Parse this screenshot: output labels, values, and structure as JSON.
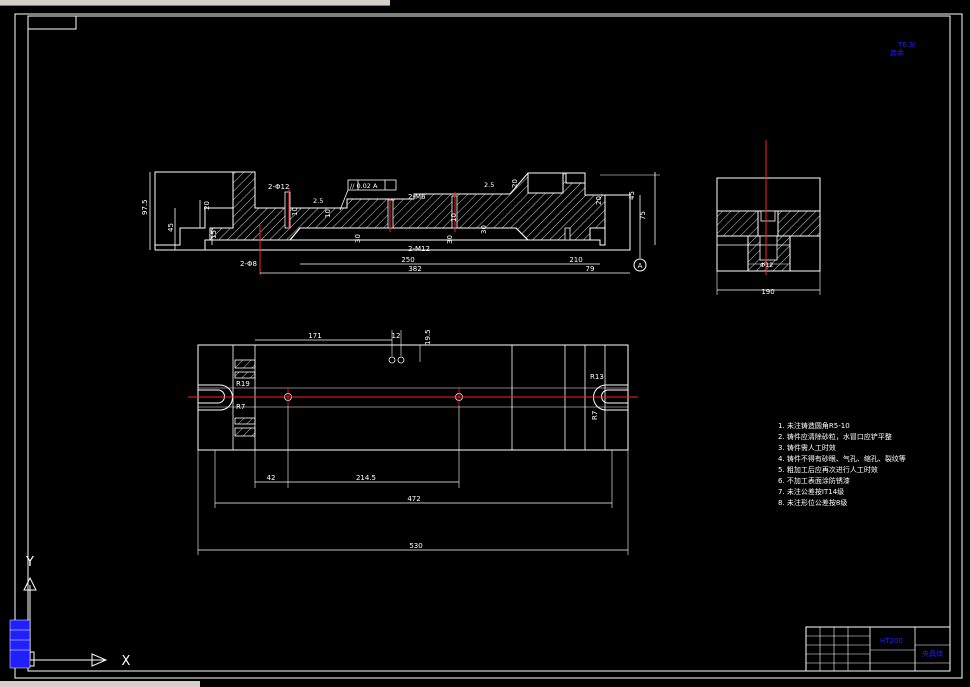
{
  "drawing": {
    "dims": {
      "front": {
        "d97_5": "97.5",
        "d45": "45",
        "d20a": "20",
        "d15": "15",
        "d2_phi12": "2-Φ12",
        "d10a": "10",
        "d2_5a": "2.5",
        "d30a": "30",
        "d2_m6": "2-M6",
        "d2_m12": "2-M12",
        "d10b": "10",
        "d30b": "30",
        "d30c": "30",
        "d2_5b": "2.5",
        "d10c": "10",
        "d20b": "20",
        "d45b": "45",
        "d75": "75",
        "d2_bar": "2-Φ8",
        "d250": "250",
        "d210": "210",
        "d382": "382",
        "d79": "79",
        "tolerance": "// 0.02 A",
        "datum": "A"
      },
      "side": {
        "d_phi": "Φ12",
        "d190": "190"
      },
      "top": {
        "d171": "171",
        "d12": "12",
        "d19_5": "19.5",
        "r19": "R19",
        "r7a": "R7",
        "r13": "R13",
        "r7b": "R7",
        "d42": "42",
        "d214_5": "214.5",
        "d472": "472",
        "d530": "530"
      }
    },
    "notes": [
      "1. 未注铸造圆角R5-10",
      "2. 铸件应清除砂粒，水冒口应铲平整",
      "3. 铸件需人工时效",
      "4. 铸件不得有砂眼、气孔、缩孔、裂纹等",
      "5. 粗加工后应再次进行人工时效",
      "6. 不加工表面涂防锈漆",
      "7. 未注公差按IT14级",
      "8. 未注形位公差按8级"
    ],
    "corner_note": {
      "line1": "T6.3/",
      "line2": "其余"
    },
    "title_block": {
      "material": "HT200",
      "name": "夹具体"
    },
    "ucs": {
      "x": "X",
      "y": "Y"
    }
  },
  "colors": {
    "background": "#000000",
    "lines": "#ffffff",
    "center_lines": "#ff2020",
    "accent_blue": "#2020ff",
    "hatch": "#ffffff"
  }
}
